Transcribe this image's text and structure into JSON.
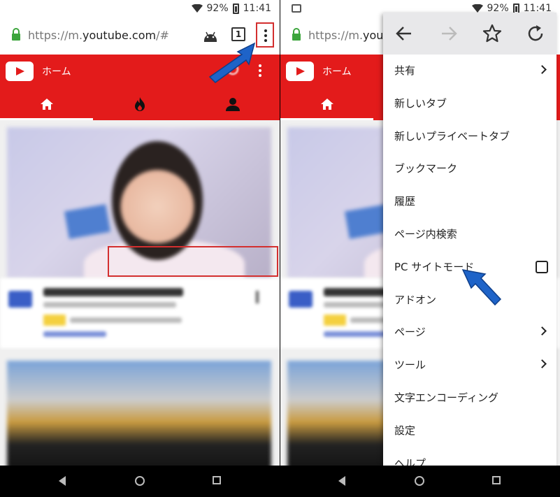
{
  "status": {
    "battery": "92%",
    "time": "11:41"
  },
  "browser": {
    "url_prefix": "https://m.",
    "url_domain": "youtube.com",
    "url_suffix": "/#",
    "url_prefix_right": "https://m.",
    "url_domain_right": "youtu",
    "tab_count": "1"
  },
  "youtube": {
    "title": "ホーム",
    "active_tab": "home"
  },
  "menu": {
    "items": [
      {
        "label": "共有",
        "submenu": true
      },
      {
        "label": "新しいタブ"
      },
      {
        "label": "新しいプライベートタブ"
      },
      {
        "label": "ブックマーク"
      },
      {
        "label": "履歴"
      },
      {
        "label": "ページ内検索"
      },
      {
        "label": "PC サイトモード",
        "checkbox": true,
        "checked": false
      },
      {
        "label": "アドオン"
      },
      {
        "label": "ページ",
        "submenu": true
      },
      {
        "label": "ツール",
        "submenu": true
      },
      {
        "label": "文字エンコーディング"
      },
      {
        "label": "設定"
      },
      {
        "label": "ヘルプ"
      }
    ]
  },
  "colors": {
    "youtube_red": "#e31b1b",
    "highlight": "#d32f2f",
    "arrow": "#1e63c8"
  }
}
